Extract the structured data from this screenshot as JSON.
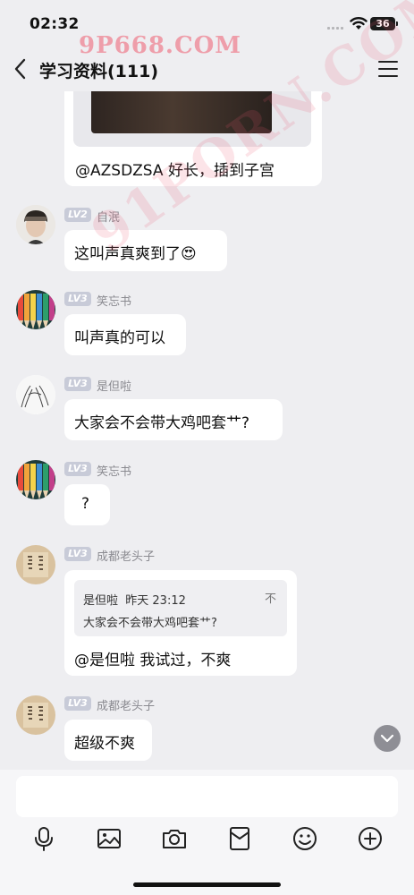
{
  "status_bar": {
    "time": "02:32",
    "battery": "36"
  },
  "header": {
    "title": "学习资料(111)"
  },
  "watermarks": {
    "top": "9P668.COM",
    "diagonal": "91PORN.COM"
  },
  "messages": [
    {
      "type": "image_text",
      "text": "@AZSDZSA 好长，插到子宫"
    },
    {
      "level": "LV2",
      "sender": "自泯",
      "text": "这叫声真爽到了😍",
      "avatar": "person-avatar"
    },
    {
      "level": "LV3",
      "sender": "笑忘书",
      "text": "叫声真的可以",
      "avatar": "colored-pencils-avatar"
    },
    {
      "level": "LV3",
      "sender": "是但啦",
      "text": "大家会不会带大鸡吧套艹?",
      "avatar": "hands-sketch-avatar"
    },
    {
      "level": "LV3",
      "sender": "笑忘书",
      "text": "?",
      "avatar": "colored-pencils-avatar"
    },
    {
      "level": "LV3",
      "sender": "成都老头子",
      "avatar": "calligraphy-avatar",
      "quote": {
        "author": "是但啦",
        "time": "昨天 23:12",
        "text": "大家会不会带大鸡吧套艹?",
        "close": "不"
      },
      "text": "@是但啦 我试过，不爽"
    },
    {
      "level": "LV3",
      "sender": "成都老头子",
      "text": "超级不爽",
      "avatar": "calligraphy-avatar"
    }
  ],
  "toolbar": [
    "microphone-icon",
    "image-icon",
    "camera-icon",
    "red-packet-icon",
    "emoji-icon",
    "plus-icon"
  ],
  "colors": {
    "background": "#eeeef1",
    "bubble": "#ffffff",
    "level_badge": "#c8cbd8",
    "watermark": "#ef5c70"
  }
}
